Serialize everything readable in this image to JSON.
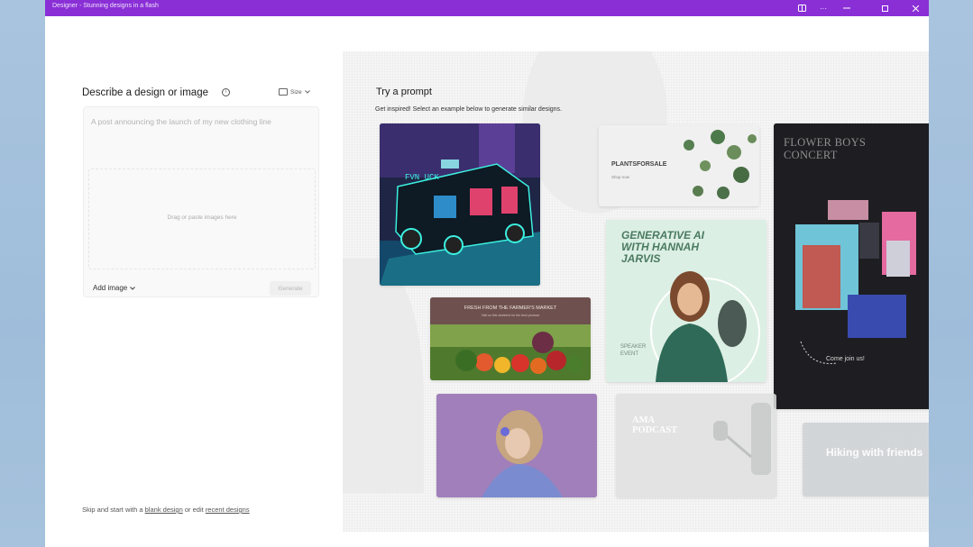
{
  "window": {
    "title": "Designer - Stunning designs in a flash",
    "accent_color": "#8a2fd6",
    "controls": [
      "layout-icon",
      "more-icon",
      "minimize-icon",
      "maximize-icon",
      "close-icon"
    ],
    "more_label": "···"
  },
  "left_panel": {
    "heading": "Describe a design or image",
    "size_label": "Size",
    "prompt_placeholder": "A post announcing the launch of my new clothing line",
    "drop_text": "Drag or paste images here",
    "add_image_label": "Add image",
    "generate_label": "Generate",
    "footer": {
      "prefix": "Skip and start with a",
      "blank_design": "blank design",
      "middle": "or edit",
      "recent_designs": "recent designs"
    }
  },
  "right_panel": {
    "title": "Try a prompt",
    "subtitle": "Get inspired! Select an example below to generate similar designs.",
    "cards": {
      "truck": {
        "sign": "FVN UCK"
      },
      "plants": {
        "title": "PLANTSFORSALE",
        "sub": "Shop now"
      },
      "flower": {
        "title": "FLOWER BOYS CONCERT",
        "cta": "Come join us!"
      },
      "genai": {
        "title": "GENERATIVE AI WITH HANNAH JARVIS",
        "sub1": "SPEAKER",
        "sub2": "EVENT"
      },
      "farm": {
        "title": "FRESH FROM THE FARMER'S MARKET",
        "sub": "Visit us this weekend for the best produce"
      },
      "podcast": {
        "title": "AMA PODCAST"
      },
      "hiking": {
        "title": "Hiking with friends"
      }
    }
  }
}
